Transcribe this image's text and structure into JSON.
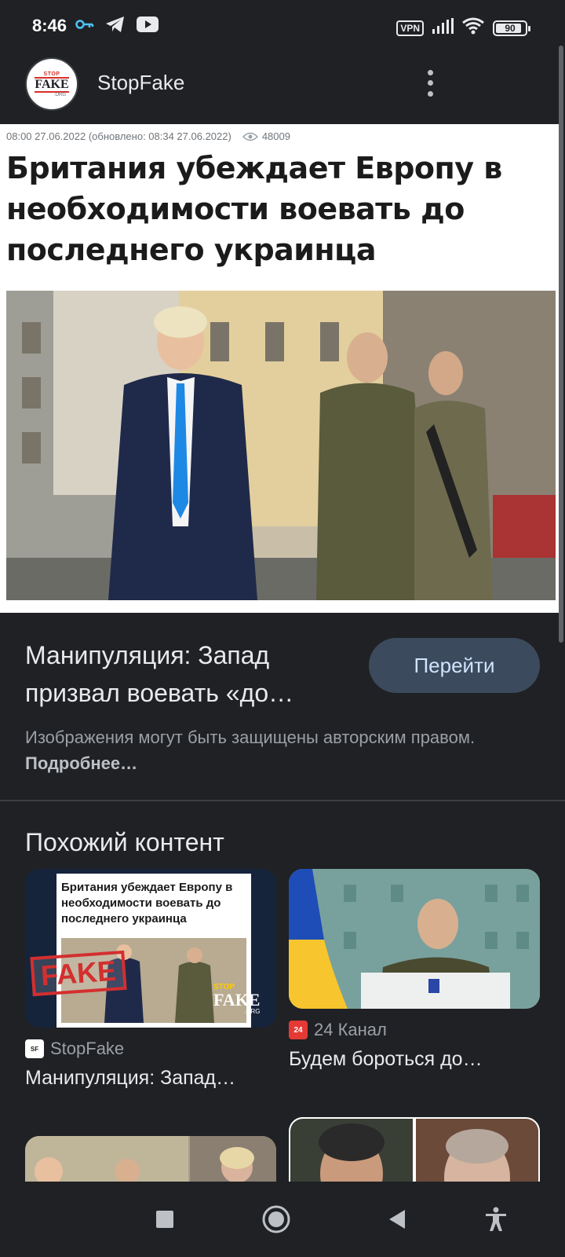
{
  "status_bar": {
    "time": "8:46",
    "vpn": "VPN",
    "battery": "90",
    "battery_level": 0.9
  },
  "app_bar": {
    "title": "StopFake",
    "avatar_top": "STOP",
    "avatar_main": "FAKE",
    "avatar_bottom": ".ORG"
  },
  "article": {
    "meta": "08:00 27.06.2022 (обновлено: 08:34 27.06.2022)",
    "views": "48009",
    "headline": "Британия убеждает Европу в необходимости воевать до последнего украинца"
  },
  "info": {
    "title": "Манипуляция: Запад призвал воевать «до…",
    "button": "Перейти",
    "copyright": "Изображения могут быть защищены авторским правом.",
    "more_link": "Подробнее…"
  },
  "similar": {
    "heading": "Похожий контент",
    "cards": [
      {
        "source": "StopFake",
        "title": "Манипуляция: Запад…",
        "thumb_headline": "Британия убеждает Европу в необходимости воевать до последнего украинца",
        "stamp": "FAKE",
        "logo_top": "STOP",
        "logo_main": "FAKE",
        "logo_bottom": ".ORG"
      },
      {
        "source": "24 Канал",
        "source_icon": "24",
        "title": "Будем бороться до…"
      }
    ]
  },
  "colors": {
    "background": "#202124",
    "button_bg": "#3c4a5e",
    "button_text": "#d2e3fc",
    "channel24_red": "#e53935"
  }
}
